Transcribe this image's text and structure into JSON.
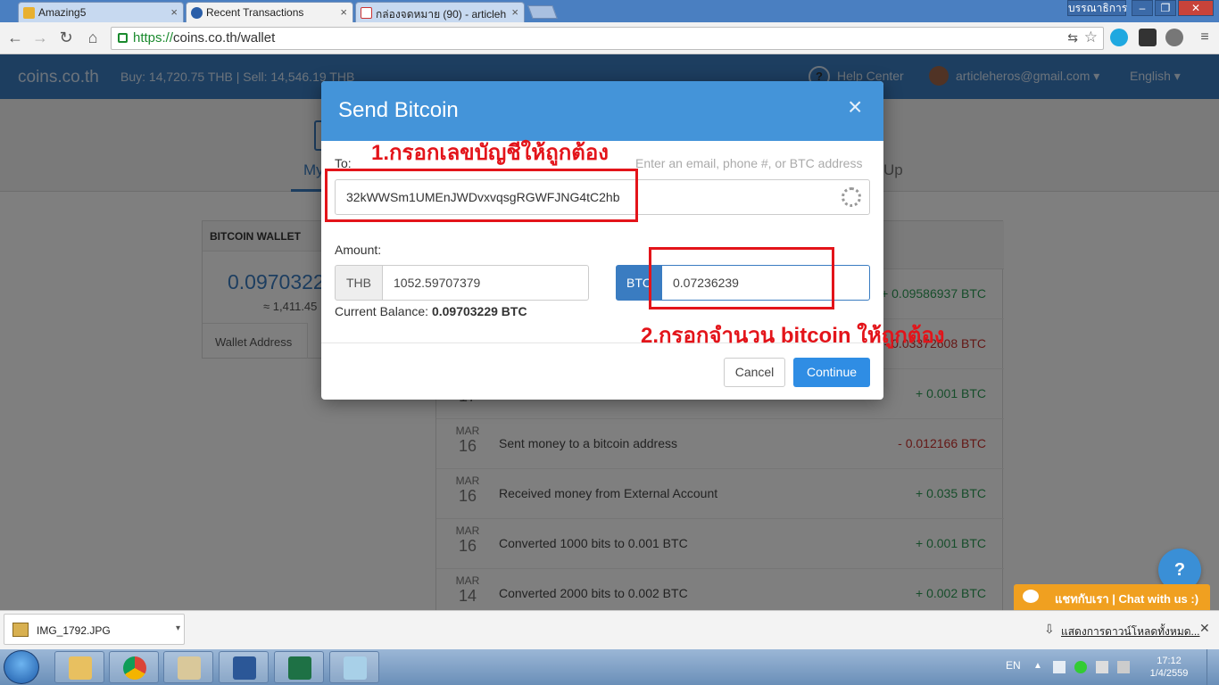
{
  "browser": {
    "tabs": [
      {
        "title": "Amazing5"
      },
      {
        "title": "Recent Transactions"
      },
      {
        "title": "กล่องจดหมาย (90) - articleh"
      }
    ],
    "window_user": "บรรณาธิการ",
    "url_scheme": "https://",
    "url_host": "coins.co.th/wallet"
  },
  "site": {
    "logo": "coins.co.th",
    "rates": "Buy: 14,720.75 THB | Sell: 14,546.19 THB",
    "help": "Help Center",
    "help_icon": "?",
    "email": "articleheros@gmail.com ▾",
    "language": "English ▾",
    "nav_left": "My",
    "nav_right": "Up"
  },
  "wallet_card": {
    "title": "BITCOIN WALLET",
    "balance": "0.0970322",
    "approx": "≈ 1,411.45",
    "address_tab": "Wallet Address"
  },
  "transactions": [
    {
      "month": "",
      "day": "",
      "desc": "",
      "amount": "+ 0.09586937 BTC",
      "sign": "pos"
    },
    {
      "month": "",
      "day": "",
      "desc": "",
      "amount": "- 0.03372608 BTC",
      "sign": "neg"
    },
    {
      "month": "",
      "day": "17",
      "desc": "",
      "amount": "+ 0.001 BTC",
      "sign": "pos"
    },
    {
      "month": "MAR",
      "day": "16",
      "desc": "Sent money to a bitcoin address",
      "amount": "- 0.012166 BTC",
      "sign": "neg"
    },
    {
      "month": "MAR",
      "day": "16",
      "desc": "Received money from External Account",
      "amount": "+ 0.035 BTC",
      "sign": "pos"
    },
    {
      "month": "MAR",
      "day": "16",
      "desc": "Converted 1000 bits to 0.001 BTC",
      "amount": "+ 0.001 BTC",
      "sign": "pos"
    },
    {
      "month": "MAR",
      "day": "14",
      "desc": "Converted 2000 bits to 0.002 BTC",
      "amount": "+ 0.002 BTC",
      "sign": "pos"
    }
  ],
  "modal": {
    "title": "Send Bitcoin",
    "close": "×",
    "to_label": "To:",
    "to_placeholder": "Enter an email, phone #, or BTC address",
    "to_value": "32kWWSm1UMEnJWDvxvqsgRGWFJNG4tC2hb",
    "amount_label": "Amount:",
    "thb_addon": "THB",
    "thb_value": "1052.59707379",
    "btc_addon": "BTC",
    "btc_value": "0.07236239",
    "current_balance_label": "Current Balance:",
    "current_balance_value": "0.09703229 BTC",
    "cancel": "Cancel",
    "continue": "Continue"
  },
  "annotations": {
    "step1": "1.กรอกเลขบัญชีให้ถูกต้อง",
    "step2": "2.กรอกจำนวน   bitcoin ให้ถูกต้อง",
    "color": "#e3141a"
  },
  "chat": {
    "bubble": "?",
    "bar": "แชทกับเรา | Chat with us :)"
  },
  "downloads": {
    "file": "IMG_1792.JPG",
    "show_all": "แสดงการดาวน์โหลดทั้งหมด..."
  },
  "taskbar": {
    "lang": "EN",
    "time": "17:12",
    "date": "1/4/2559"
  },
  "colors": {
    "accent": "#3a7cc1",
    "modal_header": "#4494d9",
    "positive": "#2c9a54",
    "negative": "#c9302c",
    "chat": "#f0a020"
  }
}
